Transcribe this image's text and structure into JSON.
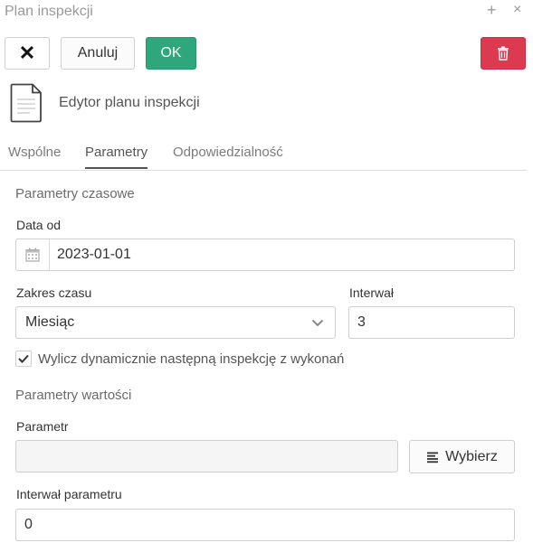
{
  "window": {
    "title": "Plan inspekcji",
    "maximize_glyph": "+",
    "close_glyph": "×"
  },
  "toolbar": {
    "close_glyph": "✕",
    "cancel_label": "Anuluj",
    "ok_label": "OK",
    "ok_color": "#2ea77c",
    "delete_color": "#dc3b4f",
    "delete_icon": "trash-icon"
  },
  "header": {
    "icon": "document-icon",
    "title": "Edytor planu inspekcji"
  },
  "tabs": [
    {
      "label": "Wspólne",
      "active": false
    },
    {
      "label": "Parametry",
      "active": true
    },
    {
      "label": "Odpowiedzialność",
      "active": false
    }
  ],
  "time_params": {
    "heading": "Parametry czasowe",
    "date_from_label": "Data od",
    "date_from_value": "2023-01-01",
    "date_icon": "calendar-icon",
    "range_label": "Zakres czasu",
    "range_value": "Miesiąc",
    "interval_label": "Interwał",
    "interval_value": "3",
    "dynamic_checkbox_label": "Wylicz dynamicznie następną inspekcję z wykonań",
    "dynamic_checked": true
  },
  "value_params": {
    "heading": "Parametry wartości",
    "param_label": "Parametr",
    "param_value": "",
    "choose_label": "Wybierz",
    "choose_icon": "list-icon",
    "param_interval_label": "Interwał parametru",
    "param_interval_value": "0"
  }
}
